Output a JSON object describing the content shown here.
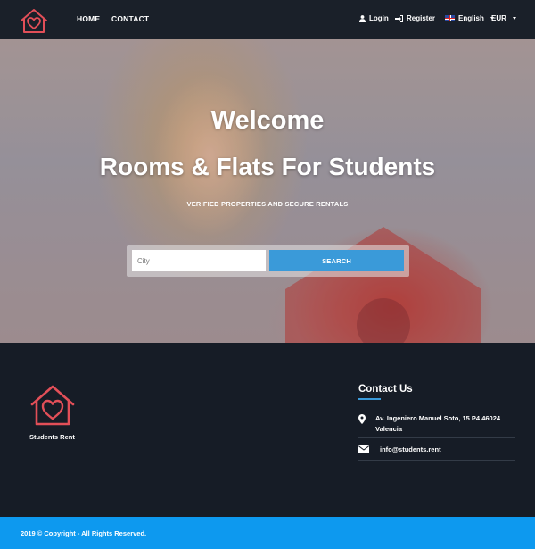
{
  "nav": {
    "home": "HOME",
    "contact": "CONTACT",
    "login": "Login",
    "register": "Register",
    "language": "English",
    "currency": "EUR"
  },
  "hero": {
    "welcome": "Welcome",
    "title": "Rooms & Flats For Students",
    "subtitle": "VERIFIED PROPERTIES AND SECURE RENTALS",
    "search_placeholder": "City",
    "search_button": "SEARCH"
  },
  "footer": {
    "brand": "Students Rent",
    "contact_title": "Contact Us",
    "address": "Av. Ingeniero Manuel Soto, 15 P4 46024 Valencia",
    "email": "info@students.rent",
    "copyright": "2019 © Copyright - All Rights Reserved."
  },
  "colors": {
    "brand_red": "#e24f58",
    "accent_blue": "#3a9ad9",
    "copy_bar_blue": "#0d99ef",
    "dark_bg": "#161c26"
  },
  "icons": [
    "house-heart-logo-icon",
    "user-icon",
    "sign-in-icon",
    "uk-flag-icon",
    "map-marker-icon",
    "envelope-icon"
  ]
}
